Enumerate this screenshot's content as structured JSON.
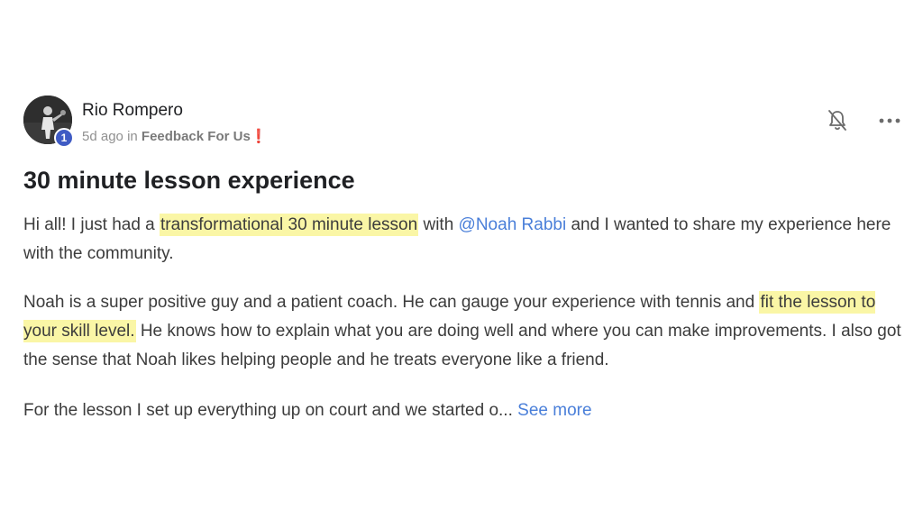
{
  "post": {
    "author": "Rio Rompero",
    "level": "1",
    "time_ago": "5d ago",
    "in_text": "in",
    "category": "Feedback For Us",
    "category_mark": "❗",
    "title": "30 minute lesson experience",
    "icons": {
      "notifications": "bell-off-icon",
      "menu": "more-horizontal-icon"
    },
    "paragraphs": {
      "p1": {
        "before": "Hi all! I just had a ",
        "highlight": "transformational 30 minute lesson",
        "middle": " with ",
        "mention": "@Noah Rabbi",
        "after": " and I wanted to share my experience here with the community."
      },
      "p2": {
        "before": "Noah is a super positive guy and a patient coach. He can gauge your experience with tennis and ",
        "highlight": "fit the lesson to your skill level.",
        "after": " He knows how to explain what you are doing well and where you can make improvements. I also got the sense that Noah likes helping people and he treats everyone like a friend."
      },
      "p3": {
        "text": "For the lesson I set up everything up on court and we started o... ",
        "see_more": "See more"
      }
    }
  },
  "colors": {
    "highlight": "#faf6a6",
    "link": "#4a7fd9",
    "badge": "#3f5bc4",
    "alert": "#d11b1b"
  }
}
